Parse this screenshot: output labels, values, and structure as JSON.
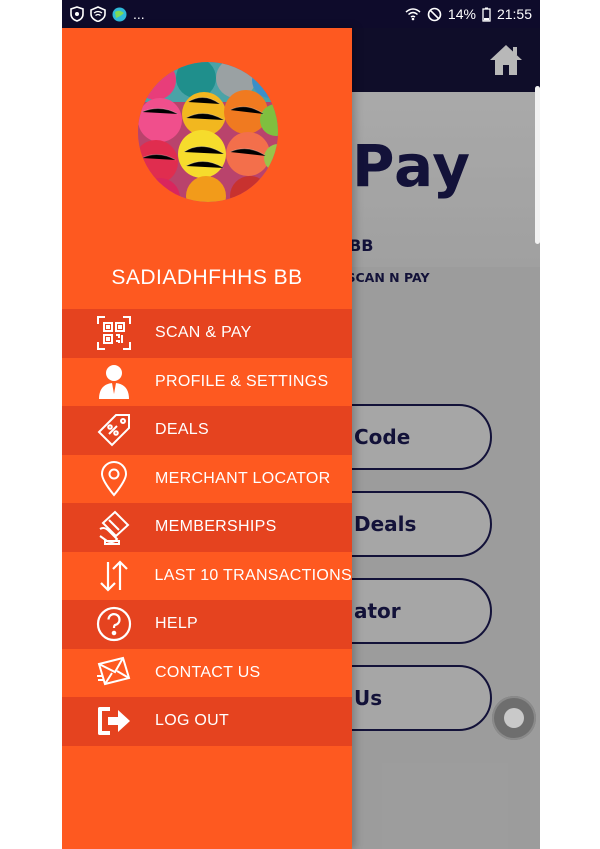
{
  "status_bar": {
    "left_more": "...",
    "battery": "14%",
    "time": "21:55"
  },
  "app": {
    "title": "Pay",
    "username_fragment": "S BB",
    "subtitle_fragment": "U SCAN N PAY",
    "buttons": [
      {
        "label": "Code"
      },
      {
        "label": "Deals"
      },
      {
        "label": "ator"
      },
      {
        "label": "Us"
      }
    ]
  },
  "drawer": {
    "user_name": "SADIADHFHHS BB",
    "menu": [
      {
        "label": "SCAN & PAY",
        "icon": "qr-code-icon"
      },
      {
        "label": "PROFILE & SETTINGS",
        "icon": "user-icon"
      },
      {
        "label": "DEALS",
        "icon": "price-tag-icon"
      },
      {
        "label": "MERCHANT LOCATOR",
        "icon": "location-pin-icon"
      },
      {
        "label": "MEMBERSHIPS",
        "icon": "membership-card-icon"
      },
      {
        "label": "LAST 10 TRANSACTIONS",
        "icon": "transfer-arrows-icon"
      },
      {
        "label": "HELP",
        "icon": "help-icon"
      },
      {
        "label": "CONTACT US",
        "icon": "mail-icon"
      },
      {
        "label": "LOG OUT",
        "icon": "logout-icon"
      }
    ]
  },
  "colors": {
    "drawer": "#fe5920",
    "drawer_dark_row": "#e5431f",
    "header": "#16133a",
    "brand_text": "#1b1950"
  }
}
